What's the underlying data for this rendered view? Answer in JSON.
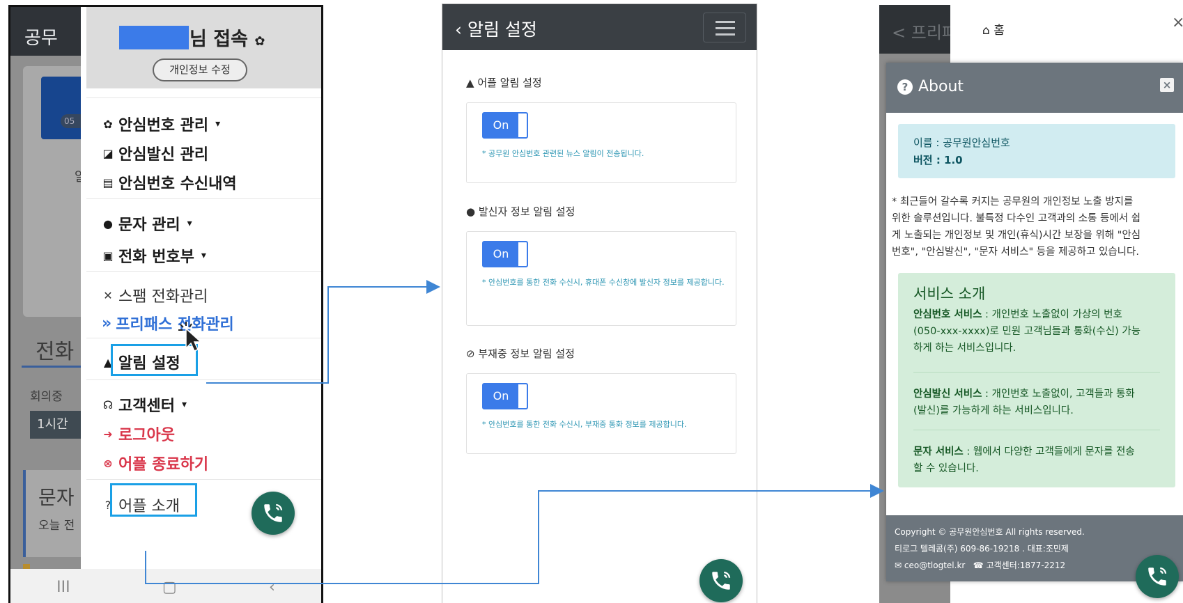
{
  "panel1": {
    "background": {
      "app_title": "공무",
      "badge": "05",
      "tab_label": "1시간",
      "section_call": "전화",
      "filter_label": "회의중",
      "section_sms": "문자",
      "sms_sub": "오늘 전",
      "side_text": "알"
    },
    "user_suffix": "님 접속",
    "edit_profile_label": "개인정보 수정",
    "menu": {
      "safe_number": "안심번호 관리",
      "safe_outgoing": "안심발신 관리",
      "safe_received": "안심번호 수신내역",
      "sms": "문자 관리",
      "phonebook": "전화 번호부",
      "spam": "스팸 전화관리",
      "prefix": "»",
      "freepass": "프리패스 전화관리",
      "notification": "알림 설정",
      "support": "고객센터",
      "logout": "로그아웃",
      "exit": "어플 종료하기",
      "about": "어플 소개"
    },
    "nav": {
      "recent": "III",
      "home": "▢",
      "back": "‹"
    }
  },
  "panel2": {
    "back_icon": "‹",
    "title": "알림 설정",
    "sections": [
      {
        "icon": "bell-icon",
        "title": "어플 알림 설정",
        "toggle": "On",
        "note": "* 공무원 안심번호 관련된 뉴스 알림이 전송됩니다."
      },
      {
        "icon": "user-icon",
        "title": "발신자 정보 알림 설정",
        "toggle": "On",
        "note": "* 안심번호를 통한 전화 수신시, 휴대폰 수신창에 발신자 정보를 제공합니다."
      },
      {
        "icon": "ban-icon",
        "title": "부재중 정보 알림 설정",
        "toggle": "On",
        "note": "* 안심번호를 통한 전화 수신시, 부재중 통화 정보를 제공합니다."
      }
    ]
  },
  "panel3": {
    "background_title": "< 프리패",
    "home_label": "홈",
    "close_label": "×",
    "modal": {
      "title": "About",
      "close": "×",
      "name_line": "이름 : 공무원안심번호",
      "version_line": "버전 : 1.0",
      "description_lines": [
        "* 최근들어 갈수록 커지는 공무원의 개인정보 노출 방지를",
        "위한 솔루션입니다. 불특정 다수인 고객과의 소통 등에서 쉽",
        "게 노출되는 개인정보 및 개인(휴식)시간 보장을 위해 \"안심",
        "번호\", \"안심발신\", \"문자 서비스\" 등을 제공하고 있습니다."
      ],
      "services_title": "서비스 소개",
      "services": [
        {
          "name": "안심번호 서비스",
          "lines": [
            " : 개인번호 노출없이 가상의 번호",
            "(050-xxx-xxxx)로 민원 고객님들과 통화(수신) 가능",
            "하게 하는 서비스입니다."
          ]
        },
        {
          "name": "안심발신 서비스",
          "lines": [
            " : 개인번호 노출없이, 고객들과 통화",
            "(발신)를 가능하게 하는 서비스입니다."
          ]
        },
        {
          "name": "문자 서비스",
          "lines": [
            " : 웹에서 다양한 고객들에게 문자를 전송",
            "할 수 있습니다."
          ]
        }
      ],
      "footer": {
        "copyright": "Copyright © 공무원안심번호 All rights reserved.",
        "company": "티로그 텔레콤(주) 609-86-19218 . 대표:조민제",
        "email": "ceo@tlogtel.kr",
        "support": "고객센터:1877-2212"
      }
    }
  },
  "colors": {
    "accent": "#3b7be9",
    "highlight": "#1aa0e6",
    "fab": "#1f6b5a",
    "navbar": "#3a3f44",
    "danger": "#d9364a"
  }
}
